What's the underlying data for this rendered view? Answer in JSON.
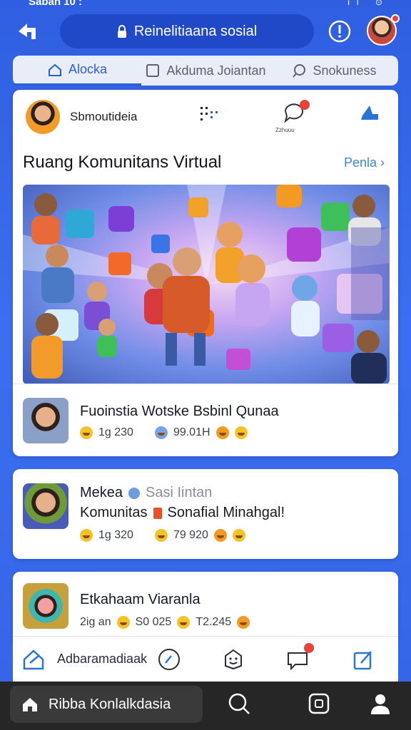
{
  "status": {
    "time": "Sabah 10 :",
    "icons": "il   ⊙"
  },
  "topbar": {
    "url": "Reinelitiaana sosial"
  },
  "tabs": [
    {
      "label": "Alocka",
      "icon": "home-outline-icon",
      "active": true
    },
    {
      "label": "Akduma Joiantan",
      "icon": "square-icon",
      "active": false
    },
    {
      "label": "Snokuness",
      "icon": "search-icon",
      "active": false
    }
  ],
  "card": {
    "user_name": "Sbmoutideia",
    "chat_label": "Zzhuuu",
    "section_title": "Ruang Komunitans Virtual",
    "section_link": "Penla ›"
  },
  "posts": [
    {
      "title": "Fuoinstia Wotske Bsbinl Qunaa",
      "stats": [
        "1g 230",
        "99.01H"
      ]
    },
    {
      "title": "Mekea",
      "subtitle": "Sasi Iintan",
      "line2": "Komunitas",
      "line2b": "Sonafial Minahgal!",
      "stats": [
        "1g 320",
        "79 920"
      ]
    },
    {
      "title": "Etkahaam Viaranla",
      "stats": [
        "2ig an",
        "S0 025",
        "T2.245"
      ]
    }
  ],
  "action_bar": {
    "label": "Adbaramadiaak"
  },
  "system_nav": {
    "home_label": "Ribba  Konlalkdasia"
  },
  "colors": {
    "accent": "#2a5fd6",
    "background": "#3565e6",
    "badge": "#e8423a"
  }
}
